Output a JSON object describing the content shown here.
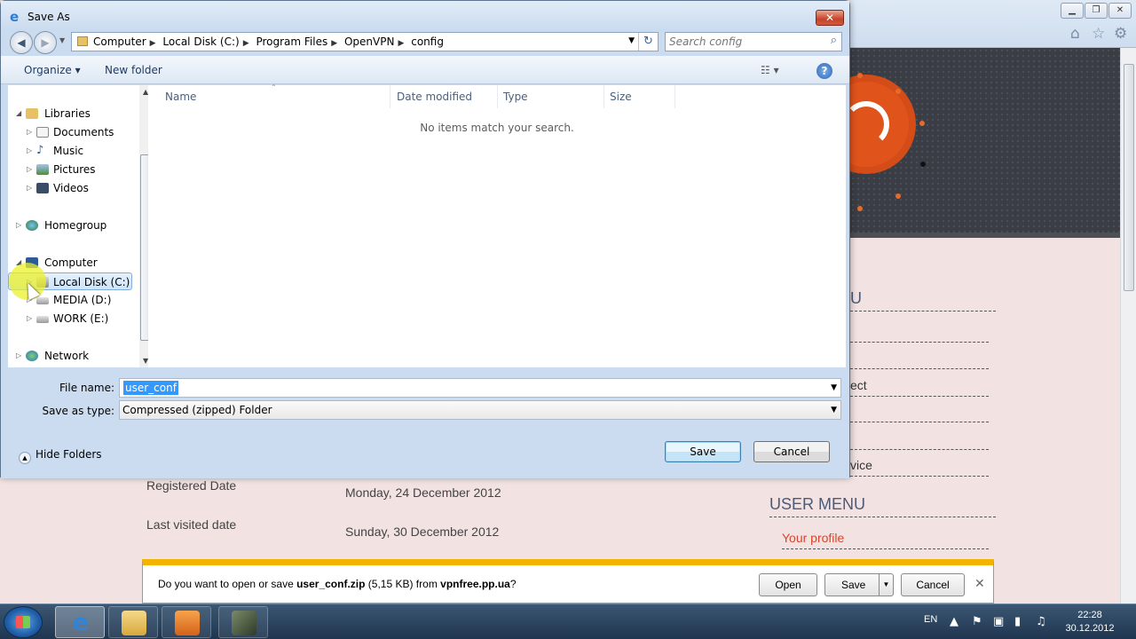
{
  "dialog": {
    "title": "Save As",
    "close_label": "✕",
    "breadcrumb": [
      "Computer",
      "Local Disk (C:)",
      "Program Files",
      "OpenVPN",
      "config"
    ],
    "search_placeholder": "Search config",
    "toolbar": {
      "organize": "Organize ▾",
      "new_folder": "New folder",
      "help": "?"
    },
    "nav_tree": [
      {
        "label": "Libraries",
        "icon": "libraries-icon"
      },
      {
        "label": "Documents",
        "icon": "documents-icon"
      },
      {
        "label": "Music",
        "icon": "music-icon"
      },
      {
        "label": "Pictures",
        "icon": "pictures-icon"
      },
      {
        "label": "Videos",
        "icon": "videos-icon"
      },
      {
        "label": "Homegroup",
        "icon": "homegroup-icon"
      },
      {
        "label": "Computer",
        "icon": "computer-icon"
      },
      {
        "label": "Local Disk (C:)",
        "icon": "drive-icon",
        "selected": true
      },
      {
        "label": "MEDIA (D:)",
        "icon": "drive-icon"
      },
      {
        "label": "WORK (E:)",
        "icon": "drive-icon"
      },
      {
        "label": "Network",
        "icon": "network-icon"
      }
    ],
    "columns": [
      "Name",
      "Date modified",
      "Type",
      "Size"
    ],
    "empty_message": "No items match your search.",
    "file_name_label": "File name:",
    "file_name_value": "user_conf",
    "save_type_label": "Save as type:",
    "save_type_value": "Compressed (zipped) Folder",
    "hide_folders": "Hide Folders",
    "save_button": "Save",
    "cancel_button": "Cancel"
  },
  "background_page": {
    "registered_label": "Registered Date",
    "registered_value": "Monday, 24 December 2012",
    "last_visited_label": "Last visited date",
    "last_visited_value": "Sunday, 30 December 2012",
    "partial_menu_head": "U",
    "partial_item_1": "ect",
    "partial_item_2": "vice",
    "user_menu_title": "USER MENU",
    "your_profile": "Your profile",
    "colors": {
      "profile_link": "#d8452a",
      "menu_heading": "#4c5a78",
      "banner_orange": "#e0541c"
    }
  },
  "notification": {
    "prefix": "Do you want to open or save ",
    "file": "user_conf.zip",
    "size": " (5,15 KB) from ",
    "site": "vpnfree.pp.ua",
    "suffix": "?",
    "open": "Open",
    "save": "Save",
    "cancel": "Cancel",
    "close": "✕"
  },
  "taskbar": {
    "lang": "EN",
    "time": "22:28",
    "date": "30.12.2012"
  }
}
